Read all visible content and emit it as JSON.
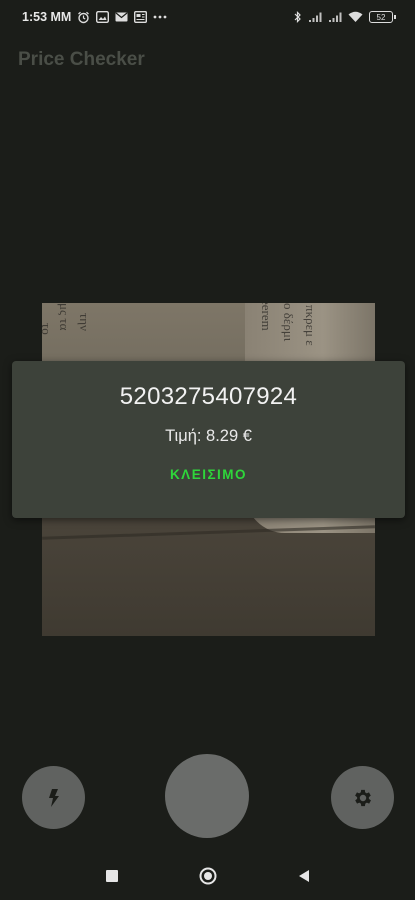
{
  "status_bar": {
    "time": "1:53 MM",
    "battery": "52",
    "icons": [
      "alarm-icon",
      "gallery-icon",
      "mail-icon",
      "news-icon",
      "more-icon",
      "bluetooth-icon",
      "signal-icon",
      "signal-icon",
      "wifi-icon",
      "battery-icon"
    ]
  },
  "app_bar": {
    "title": "Price Checker"
  },
  "camera_preview": {
    "texts": [
      "το",
      "μς τα",
      "την",
      "eerem",
      "ο δέρμι",
      "πκρεμ ε"
    ]
  },
  "dialog": {
    "barcode": "5203275407924",
    "price": "Τιμή: 8.29 €",
    "close_label": "ΚΛΕΙΣΙΜΟ",
    "accent_color": "#2ed63a"
  },
  "controls": {
    "flash_icon": "flash-icon",
    "shutter": "shutter-button",
    "settings_icon": "gear-icon"
  },
  "nav_bar": {
    "icons": [
      "recents-icon",
      "home-icon",
      "back-icon"
    ]
  }
}
